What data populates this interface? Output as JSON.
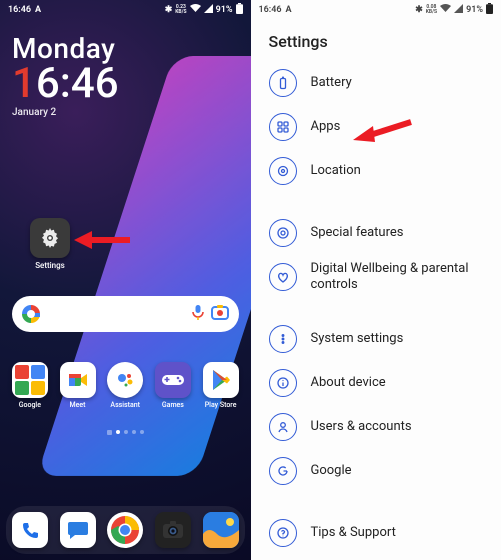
{
  "status_left": {
    "time": "16:46",
    "icon": "A"
  },
  "status_right": {
    "bt": "✱",
    "net": "0.23\nKB/S",
    "wifi": "▾",
    "signal": "◢",
    "battery_pct": "91%",
    "battery_icon": "▮"
  },
  "home": {
    "day": "Monday",
    "time_h": "1",
    "time_rest": "6:46",
    "date": "January 2",
    "settings_label": "Settings",
    "apps": [
      {
        "label": "Google"
      },
      {
        "label": "Meet"
      },
      {
        "label": "Assistant"
      },
      {
        "label": "Games"
      },
      {
        "label": "Play Store"
      }
    ],
    "dock": [
      {
        "name": "phone"
      },
      {
        "name": "messages"
      },
      {
        "name": "chrome"
      },
      {
        "name": "camera"
      },
      {
        "name": "photos"
      }
    ]
  },
  "settings": {
    "title": "Settings",
    "items": [
      {
        "label": "Battery"
      },
      {
        "label": "Apps"
      },
      {
        "label": "Location"
      }
    ],
    "items2": [
      {
        "label": "Special features"
      },
      {
        "label": "Digital Wellbeing & parental controls"
      }
    ],
    "items3": [
      {
        "label": "System settings"
      },
      {
        "label": "About device"
      },
      {
        "label": "Users & accounts"
      },
      {
        "label": "Google"
      }
    ],
    "items4": [
      {
        "label": "Tips & Support"
      }
    ]
  },
  "status_right_settings": {
    "net": "0.08\nKB/S"
  }
}
